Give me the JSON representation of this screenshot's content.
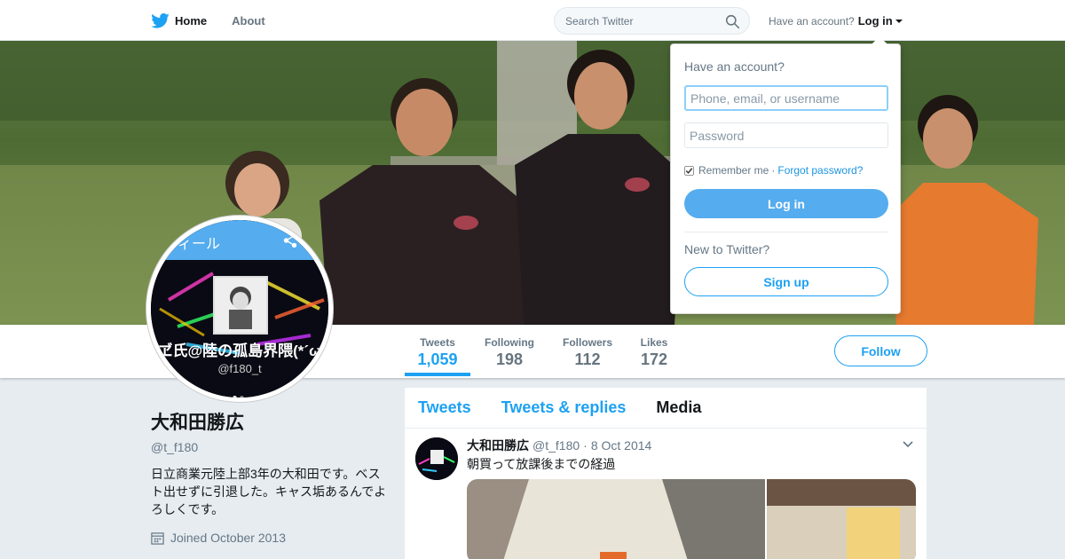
{
  "nav": {
    "home_label": "Home",
    "about_label": "About",
    "search_placeholder": "Search Twitter",
    "have_account_text": "Have an account?",
    "login_label": "Log in"
  },
  "avatar_card": {
    "header_text": "ィール",
    "name_text": "ヹ氏@陸の孤島界隈(*´ω",
    "handle_text": "@f180_t"
  },
  "stats": [
    {
      "label": "Tweets",
      "value": "1,059"
    },
    {
      "label": "Following",
      "value": "198"
    },
    {
      "label": "Followers",
      "value": "112"
    },
    {
      "label": "Likes",
      "value": "172"
    }
  ],
  "follow_label": "Follow",
  "profile": {
    "name": "大和田勝広",
    "handle": "@t_f180",
    "bio": "日立商業元陸上部3年の大和田です。ベスト出せずに引退した。キャス垢あるんでよろしくです。",
    "joined": "Joined October 2013"
  },
  "timeline": {
    "tabs": [
      "Tweets",
      "Tweets & replies",
      "Media"
    ],
    "tweet": {
      "name": "大和田勝広",
      "handle": "@t_f180",
      "date": "8 Oct 2014",
      "separator": "·",
      "text": "朝買って放課後までの経過"
    }
  },
  "login_dropdown": {
    "title": "Have an account?",
    "username_placeholder": "Phone, email, or username",
    "password_placeholder": "Password",
    "remember_label": "Remember me",
    "separator": "·",
    "forgot_label": "Forgot password?",
    "login_button": "Log in",
    "new_text": "New to Twitter?",
    "signup_button": "Sign up"
  },
  "colors": {
    "accent": "#1da1f2",
    "login_button": "#55acee",
    "background": "#e6ecf0"
  }
}
